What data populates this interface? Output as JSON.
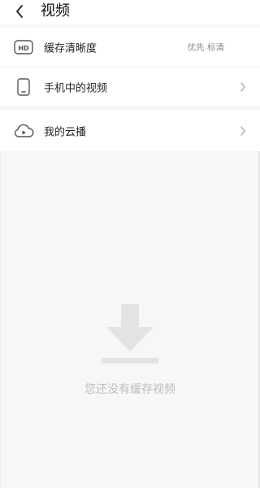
{
  "header": {
    "back_icon": "chevron-left-icon",
    "title": "视频"
  },
  "menu": {
    "cache_quality": {
      "icon": "hd-icon",
      "label": "缓存清晰度",
      "value": "优先 标清"
    },
    "phone_videos": {
      "icon": "phone-icon",
      "label": "手机中的视频",
      "chevron": "chevron-right-icon"
    },
    "cloud_play": {
      "icon": "cloud-play-icon",
      "label": "我的云播",
      "chevron": "chevron-right-icon"
    }
  },
  "empty_state": {
    "icon": "download-icon",
    "message": "您还没有缓存视频"
  },
  "colors": {
    "background": "#f7f7f7",
    "card": "#ffffff",
    "text": "#222222",
    "muted": "#8a8a8a",
    "empty_icon": "#e3e3e3",
    "empty_text": "#bdbdbd"
  }
}
